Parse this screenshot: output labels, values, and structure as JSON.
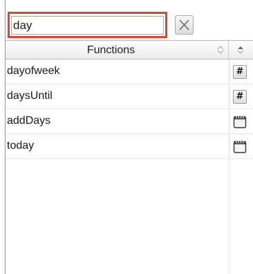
{
  "search": {
    "value": "day",
    "highlight_color": "#e8402f",
    "clear_icon": "close-icon"
  },
  "table": {
    "columns": [
      {
        "label": "Functions",
        "icon": "sort-indicator-icon"
      },
      {
        "label": "",
        "icon": "sort-indicator-icon"
      }
    ],
    "rows": [
      {
        "name": "dayofweek",
        "type_icon": "hash-icon",
        "type_glyph": "#"
      },
      {
        "name": "daysUntil",
        "type_icon": "hash-icon",
        "type_glyph": "#"
      },
      {
        "name": "addDays",
        "type_icon": "calendar-icon",
        "type_glyph": ""
      },
      {
        "name": "today",
        "type_icon": "calendar-icon",
        "type_glyph": ""
      }
    ]
  }
}
